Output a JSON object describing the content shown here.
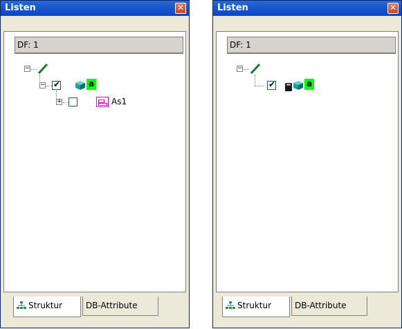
{
  "panels": [
    {
      "title": "Listen",
      "df_label": "DF: 1",
      "tree": {
        "root": {
          "expanded": true,
          "icon": "green-line-icon"
        },
        "child": {
          "expanded": true,
          "checked": true,
          "icons": [
            "cube-icon"
          ],
          "badge": "a"
        },
        "grandchild": {
          "expanded": false,
          "checked": false,
          "icon": "list-icon",
          "label": "As1"
        }
      },
      "tabs": [
        {
          "label": "Struktur",
          "active": true,
          "icon": "tree-structure-icon"
        },
        {
          "label": "DB-Attribute",
          "active": false
        }
      ]
    },
    {
      "title": "Listen",
      "df_label": "DF: 1",
      "tree": {
        "root": {
          "expanded": true,
          "icon": "green-line-icon"
        },
        "child": {
          "checked": true,
          "icons": [
            "floppy-icon",
            "cube-icon"
          ],
          "badge": "a"
        }
      },
      "tabs": [
        {
          "label": "Struktur",
          "active": true,
          "icon": "tree-structure-icon"
        },
        {
          "label": "DB-Attribute",
          "active": false
        }
      ]
    }
  ],
  "colors": {
    "titlebar": "#0b47c0",
    "badge": "#00ff00",
    "list_icon": "#e000e0",
    "cube": "#1aa0a0"
  }
}
